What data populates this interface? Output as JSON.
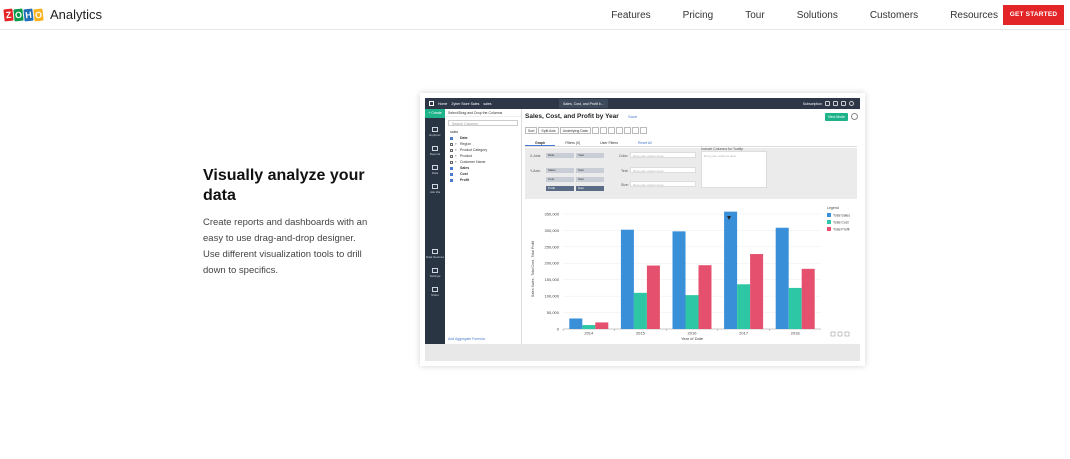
{
  "nav": {
    "brand_letters": [
      "Z",
      "O",
      "H",
      "O"
    ],
    "brand_colors": [
      "#e42527",
      "#089949",
      "#226db4",
      "#f9b21d"
    ],
    "brand_name": "Analytics",
    "links": [
      "Features",
      "Pricing",
      "Tour",
      "Solutions",
      "Customers",
      "Resources"
    ],
    "cta": "GET STARTED"
  },
  "hero": {
    "title_line1": "Visually analyze your",
    "title_line2": "data",
    "desc_line1": "Create reports and dashboards with an",
    "desc_line2": "easy to use drag-and-drop designer.",
    "desc_line3": "Use different visualization tools to drill",
    "desc_line4": "down to specifics."
  },
  "app": {
    "top": {
      "home": "Home",
      "workspace": "Zyber Store Sales",
      "table": "sales",
      "tab": "Sales, Cost, and Profit b...",
      "subscription": "Subscription"
    },
    "leftbar": {
      "create": "+ Create",
      "items": [
        "Explorer",
        "Reports",
        "Data",
        "Ask Zia"
      ],
      "bottom_items": [
        "Data Sources",
        "Settings",
        "Share"
      ]
    },
    "columns": {
      "header": "Select/Drag and Drop the Columns",
      "search_placeholder": "Search Columns",
      "table": "sales",
      "rows": [
        {
          "type": "",
          "name": "Date",
          "checked": true,
          "bold": true
        },
        {
          "type": "T",
          "name": "Region",
          "checked": false,
          "bold": false
        },
        {
          "type": "T",
          "name": "Product Category",
          "checked": false,
          "bold": false
        },
        {
          "type": "T",
          "name": "Product",
          "checked": false,
          "bold": false
        },
        {
          "type": "T",
          "name": "Customer Name",
          "checked": false,
          "bold": false
        },
        {
          "type": "",
          "name": "Sales",
          "checked": true,
          "bold": true
        },
        {
          "type": "",
          "name": "Cost",
          "checked": true,
          "bold": true
        },
        {
          "type": "",
          "name": "Profit",
          "checked": true,
          "bold": true
        }
      ],
      "footer": "Add Aggregate Formula"
    },
    "report": {
      "title": "Sales, Cost, and Profit by Year",
      "save": "Save",
      "view_mode": "View Mode",
      "toolbar": [
        "Sort",
        "Split Axis",
        "Underlying Data"
      ],
      "tabs": [
        "Graph",
        "Filters (0)",
        "User Filters",
        "Reset All"
      ],
      "xaxis_label": "X-Axis:",
      "yaxis_label": "Y-Axis:",
      "x_pill": "Date",
      "x_fn": "Year",
      "y_pills": [
        {
          "name": "Sales",
          "fn": "Sum"
        },
        {
          "name": "Cost",
          "fn": "Sum"
        },
        {
          "name": "Profit",
          "fn": "Sum"
        }
      ],
      "color_label": "Color:",
      "text_label": "Text:",
      "size_label": "Size:",
      "drop_placeholder": "Drop your column here",
      "tooltip_label": "Include Columns for Tooltip",
      "tooltip_placeholder": "Drop your columns here"
    }
  },
  "chart_data": {
    "type": "bar",
    "categories": [
      "2014",
      "2015",
      "2016",
      "2017",
      "2018"
    ],
    "series": [
      {
        "name": "Total Sales",
        "color": "#3a8fd9",
        "values": [
          32000,
          302000,
          297000,
          357000,
          308000
        ]
      },
      {
        "name": "Total Cost",
        "color": "#2dc7a5",
        "values": [
          12000,
          110000,
          103000,
          136000,
          125000
        ]
      },
      {
        "name": "Total Profit",
        "color": "#e4506e",
        "values": [
          20000,
          193000,
          194000,
          228000,
          183000
        ]
      }
    ],
    "yticks": [
      "0",
      "50,000",
      "100,000",
      "150,000",
      "200,000",
      "250,000",
      "300,000",
      "350,000"
    ],
    "ylim": [
      0,
      365000
    ],
    "xlabel": "Year of Date",
    "ylabel": "Sales Sales , Total Cost , Total Profit",
    "legend_title": "Legend",
    "legend_position": "right"
  }
}
